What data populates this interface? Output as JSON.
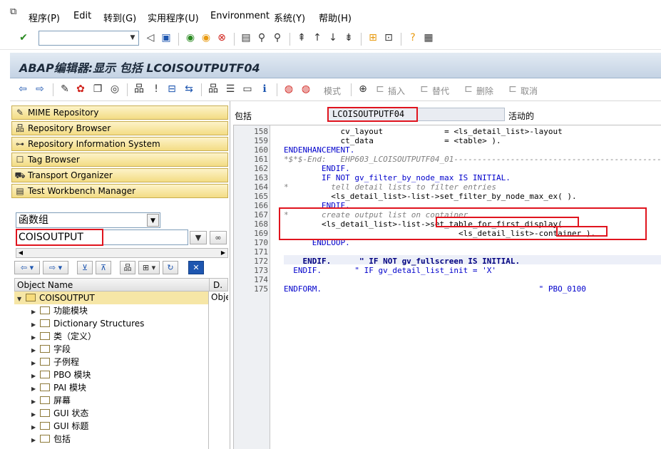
{
  "menubar": {
    "items": [
      "程序(P)",
      "Edit",
      "转到(G)",
      "实用程序(U)",
      "Environment",
      "系统(Y)",
      "帮助(H)"
    ]
  },
  "standard_toolbar": {
    "command_field_value": ""
  },
  "title": "ABAP编辑器:显示 包括 LCOISOUTPUTF04",
  "app_toolbar": {
    "mode_label": "模式",
    "insert_label": "插入",
    "replace_label": "替代",
    "delete_label": "删除",
    "cancel_label": "取消"
  },
  "navigation": {
    "buttons": [
      "MIME Repository",
      "Repository Browser",
      "Repository Information System",
      "Tag Browser",
      "Transport Organizer",
      "Test Workbench Manager"
    ],
    "object_type": "函数组",
    "object_name": "COISOUTPUT"
  },
  "tree": {
    "col_name": "Object Name",
    "col_desc": "D.",
    "root": {
      "label": "COISOUTPUT",
      "desc": "Obje"
    },
    "children": [
      "功能模块",
      "Dictionary Structures",
      "类（定义）",
      "字段",
      "子例程",
      "PBO 模块",
      "PAI 模块",
      "屏幕",
      "GUI 状态",
      "GUI 标题",
      "包括"
    ]
  },
  "editor": {
    "include_label": "包括",
    "include_name": "LCOISOUTPUTF04",
    "status": "活动的",
    "lines": [
      {
        "n": "158",
        "t": "            cv_layout             = <ls_detail_list>-layout"
      },
      {
        "n": "159",
        "t": "            ct_data               = <table> )."
      },
      {
        "n": "160",
        "t": "ENDENHANCEMENT."
      },
      {
        "n": "161",
        "t": "*$*$-End:   EHP603_LCOISOUTPUTF04_01--------------------------------------------"
      },
      {
        "n": "162",
        "t": "        ENDIF."
      },
      {
        "n": "163",
        "t": "        IF NOT gv_filter_by_node_max IS INITIAL."
      },
      {
        "n": "164",
        "t": "*         tell detail lists to filter entries"
      },
      {
        "n": "165",
        "t": "          <ls_detail_list>-list->set_filter_by_node_max_ex( )."
      },
      {
        "n": "166",
        "t": "        ENDIF."
      },
      {
        "n": "167",
        "t": "*       create output list on container"
      },
      {
        "n": "168",
        "t": "        <ls_detail_list>-list->set_table_for_first_display("
      },
      {
        "n": "169",
        "t": "                                     <ls_detail_list>-container )."
      },
      {
        "n": "170",
        "t": "      ENDLOOP."
      },
      {
        "n": "171",
        "t": ""
      },
      {
        "n": "172",
        "t": "    ENDIF.      \" IF NOT gv_fullscreen IS INITIAL."
      },
      {
        "n": "173",
        "t": "  ENDIF.       \" IF gv_detail_list_init = 'X'"
      },
      {
        "n": "174",
        "t": ""
      },
      {
        "n": "175",
        "t": "ENDFORM.                                              \" PBO_0100"
      }
    ]
  }
}
